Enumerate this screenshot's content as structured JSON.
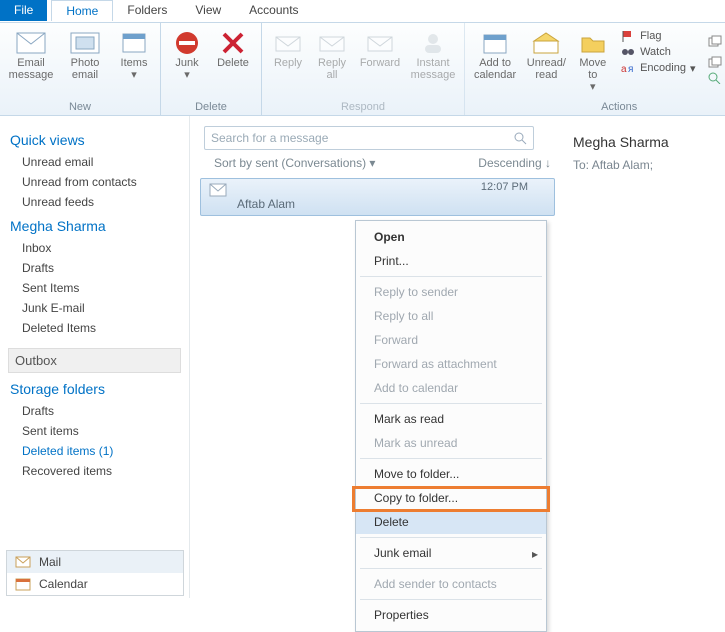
{
  "menubar": {
    "file": "File",
    "home": "Home",
    "folders": "Folders",
    "view": "View",
    "accounts": "Accounts"
  },
  "ribbon": {
    "new": {
      "title": "New",
      "email": "Email message",
      "photo": "Photo email",
      "items": "Items"
    },
    "delete": {
      "title": "Delete",
      "junk": "Junk",
      "del": "Delete"
    },
    "respond": {
      "title": "Respond",
      "reply": "Reply",
      "replyall": "Reply all",
      "forward": "Forward",
      "instant": "Instant message"
    },
    "actions": {
      "title": "Actions",
      "addcal": "Add to calendar",
      "unread": "Unread/ read",
      "moveto": "Move to",
      "flag": "Flag",
      "watch": "Watch",
      "encoding": "Encoding",
      "copyto": "Copy to",
      "copy": "Copy",
      "find": "Find"
    }
  },
  "sidebar": {
    "quick": {
      "title": "Quick views",
      "items": [
        "Unread email",
        "Unread from contacts",
        "Unread feeds"
      ]
    },
    "account": {
      "title": "Megha Sharma",
      "items": [
        "Inbox",
        "Drafts",
        "Sent Items",
        "Junk E-mail",
        "Deleted Items"
      ]
    },
    "outbox": "Outbox",
    "storage": {
      "title": "Storage folders",
      "items": [
        "Drafts",
        "Sent items",
        "Deleted items (1)",
        "Recovered items"
      ]
    },
    "nav": {
      "mail": "Mail",
      "calendar": "Calendar"
    }
  },
  "list": {
    "search_placeholder": "Search for a message",
    "sort": "Sort by sent (Conversations)",
    "order": "Descending",
    "message": {
      "from": "Aftab Alam",
      "time": "12:07 PM"
    }
  },
  "reading": {
    "from": "Megha Sharma",
    "to_label": "To:",
    "to": "Aftab Alam;"
  },
  "context": {
    "open": "Open",
    "print": "Print...",
    "rsender": "Reply to sender",
    "rall": "Reply to all",
    "fwd": "Forward",
    "fwdatt": "Forward as attachment",
    "addcal": "Add to calendar",
    "markread": "Mark as read",
    "markunread": "Mark as unread",
    "moveto": "Move to folder...",
    "copyto": "Copy to folder...",
    "delete": "Delete",
    "junk": "Junk email",
    "addsender": "Add sender to contacts",
    "props": "Properties"
  }
}
